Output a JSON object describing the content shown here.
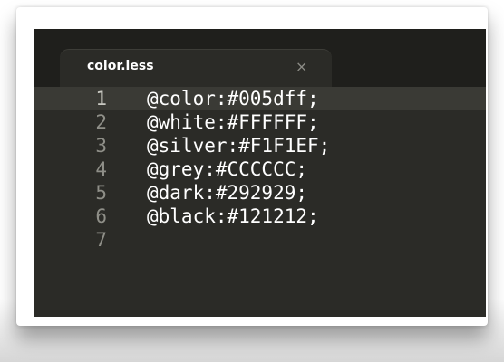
{
  "tab": {
    "label": "color.less",
    "close_glyph": "×"
  },
  "code": {
    "lines": [
      {
        "number": "1",
        "text": "@color:#005dff;"
      },
      {
        "number": "2",
        "text": "@white:#FFFFFF;"
      },
      {
        "number": "3",
        "text": "@silver:#F1F1EF;"
      },
      {
        "number": "4",
        "text": "@grey:#CCCCCC;"
      },
      {
        "number": "5",
        "text": "@dark:#292929;"
      },
      {
        "number": "6",
        "text": "@black:#121212;"
      },
      {
        "number": "7",
        "text": ""
      }
    ],
    "current_line": 1
  },
  "colors": {
    "editor_background": "#2b2b27",
    "tab_bar_background": "#1f1f1c",
    "text": "#ffffff",
    "line_number": "#8f8f88"
  },
  "icons": {
    "tab_close": "close-icon"
  }
}
